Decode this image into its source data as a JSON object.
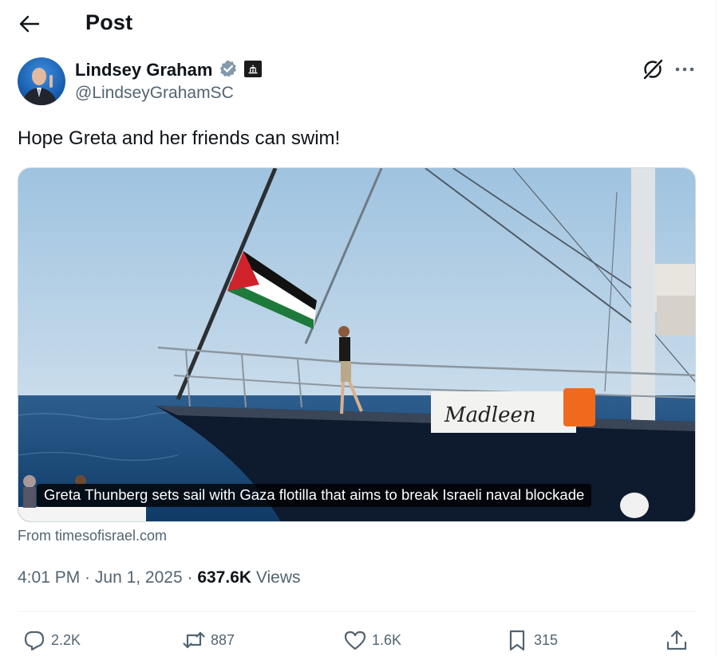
{
  "header": {
    "title": "Post"
  },
  "author": {
    "name": "Lindsey Graham",
    "handle": "@LindseyGrahamSC"
  },
  "post": {
    "text": "Hope Greta and her friends can swim!"
  },
  "card": {
    "caption": "Greta Thunberg sets sail with Gaza flotilla that aims to break Israeli naval blockade",
    "source": "From timesofisrael.com",
    "boat_name": "Madleen"
  },
  "meta": {
    "time": "4:01 PM",
    "separator1": " · ",
    "date": "Jun 1, 2025",
    "separator2": " · ",
    "views_count": "637.6K",
    "views_label": " Views"
  },
  "actions": {
    "replies": "2.2K",
    "reposts": "887",
    "likes": "1.6K",
    "bookmarks": "315"
  },
  "colors": {
    "text": "#0f1419",
    "secondary": "#536471",
    "verified": "#829aab",
    "border": "#eff3f4"
  },
  "icons": [
    "back-arrow-icon",
    "verified-icon",
    "government-affiliation-icon",
    "grok-icon",
    "more-icon",
    "reply-icon",
    "repost-icon",
    "like-icon",
    "bookmark-icon",
    "share-icon"
  ]
}
